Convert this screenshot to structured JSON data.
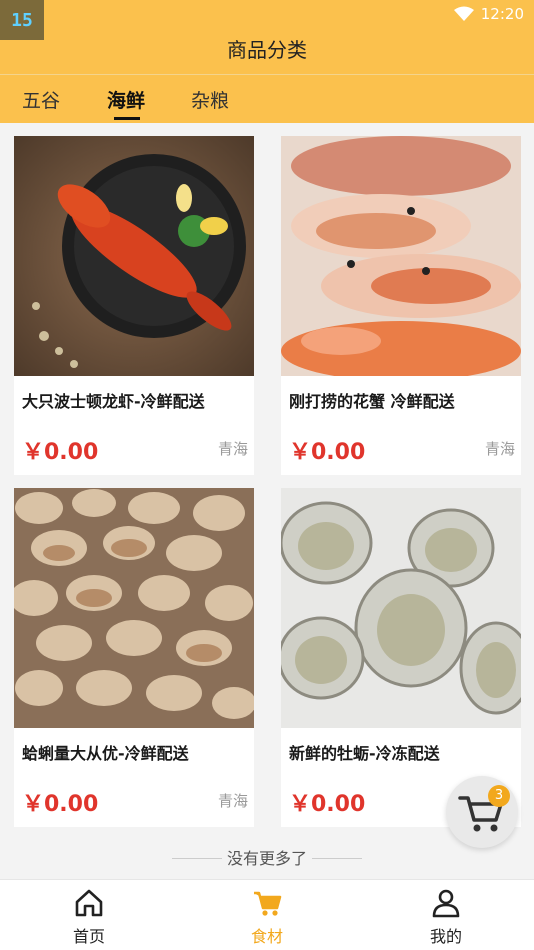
{
  "status_bar": {
    "app_badge": "15",
    "time": "12:20"
  },
  "header": {
    "title": "商品分类"
  },
  "tabs": [
    {
      "label": "五谷"
    },
    {
      "label": "海鲜",
      "active": true
    },
    {
      "label": "杂粮"
    }
  ],
  "products": [
    {
      "name": "大只波士顿龙虾-冷鲜配送",
      "price": "￥0.00",
      "location": "青海",
      "image": "lobster"
    },
    {
      "name": "刚打捞的花蟹 冷鲜配送",
      "price": "￥0.00",
      "location": "青海",
      "image": "crab"
    },
    {
      "name": "蛤蜊量大从优-冷鲜配送",
      "price": "￥0.00",
      "location": "青海",
      "image": "clams"
    },
    {
      "name": "新鲜的牡蛎-冷冻配送",
      "price": "￥0.00",
      "location": "",
      "image": "oysters"
    }
  ],
  "footer_note": "没有更多了",
  "cart_fab": {
    "count": "3",
    "icon": "cart-icon"
  },
  "bottom_nav": [
    {
      "label": "首页",
      "icon": "home-icon"
    },
    {
      "label": "食材",
      "icon": "cart-icon",
      "active": true
    },
    {
      "label": "我的",
      "icon": "user-icon"
    }
  ],
  "colors": {
    "accent": "#fbc14d",
    "price": "#e0352c",
    "active_nav": "#f2a81d"
  }
}
